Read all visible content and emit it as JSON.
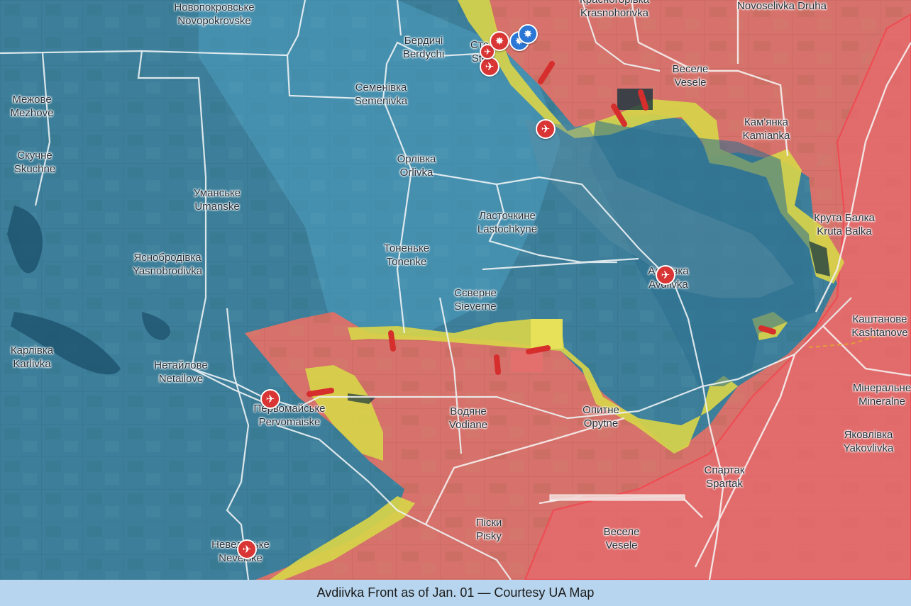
{
  "caption": "Avdiivka Front as of Jan. 01 — Courtesy UA Map",
  "colors": {
    "ukraine_controlled": "#3f8aa8",
    "russia_controlled": "#d9746e",
    "contested": "#d9d84a",
    "roads": "#f4f4f4"
  },
  "places": [
    {
      "native": "Новопокровське",
      "latin": "Novopokrovske"
    },
    {
      "native": "Бердичі",
      "latin": "Berdychi"
    },
    {
      "native": "Сте",
      "latin": "Ste"
    },
    {
      "native": "Красногорівка",
      "latin": "Krasnohorivka"
    },
    {
      "native": "",
      "latin": "Novoselivka Druha"
    },
    {
      "native": "Межове",
      "latin": "Mezhove"
    },
    {
      "native": "Семенівка",
      "latin": "Semenivka"
    },
    {
      "native": "Веселе",
      "latin": "Vesele"
    },
    {
      "native": "Кам'янка",
      "latin": "Kamianka"
    },
    {
      "native": "Скучне",
      "latin": "Skuchne"
    },
    {
      "native": "Орлівка",
      "latin": "Orlivka"
    },
    {
      "native": "Уманське",
      "latin": "Umanske"
    },
    {
      "native": "Ласточкине",
      "latin": "Lastochkyne"
    },
    {
      "native": "Крута Балка",
      "latin": "Kruta Balka"
    },
    {
      "native": "Яснобродівка",
      "latin": "Yasnobrodivka"
    },
    {
      "native": "Тоненьке",
      "latin": "Tonenke"
    },
    {
      "native": "Авдіївка",
      "latin": "Avdiivka"
    },
    {
      "native": "Сєверне",
      "latin": "Sieverne"
    },
    {
      "native": "Каштанове",
      "latin": "Kashtanove"
    },
    {
      "native": "Карлівка",
      "latin": "Karlivka"
    },
    {
      "native": "Нетайлове",
      "latin": "Netailove"
    },
    {
      "native": "Мінеральне",
      "latin": "Mineralne"
    },
    {
      "native": "Первомайське",
      "latin": "Pervomaiske"
    },
    {
      "native": "Водяне",
      "latin": "Vodiane"
    },
    {
      "native": "Опитне",
      "latin": "Opytne"
    },
    {
      "native": "Яковлівка",
      "latin": "Yakovlivka"
    },
    {
      "native": "Спартак",
      "latin": "Spartak"
    },
    {
      "native": "Піски",
      "latin": "Pisky"
    },
    {
      "native": "Веселе",
      "latin": "Vesele"
    },
    {
      "native": "Невельське",
      "latin": "Nevelske"
    }
  ],
  "markers": [
    {
      "type": "airstrike",
      "icon": "plane-icon"
    },
    {
      "type": "airstrike",
      "icon": "plane-icon"
    },
    {
      "type": "airstrike",
      "icon": "plane-icon"
    },
    {
      "type": "airstrike",
      "icon": "plane-icon"
    },
    {
      "type": "airstrike",
      "icon": "plane-icon"
    },
    {
      "type": "airstrike",
      "icon": "plane-icon"
    },
    {
      "type": "explosion",
      "icon": "explosion-icon"
    },
    {
      "type": "explosion-blue",
      "icon": "explosion-icon"
    },
    {
      "type": "explosion-blue",
      "icon": "explosion-icon"
    }
  ]
}
